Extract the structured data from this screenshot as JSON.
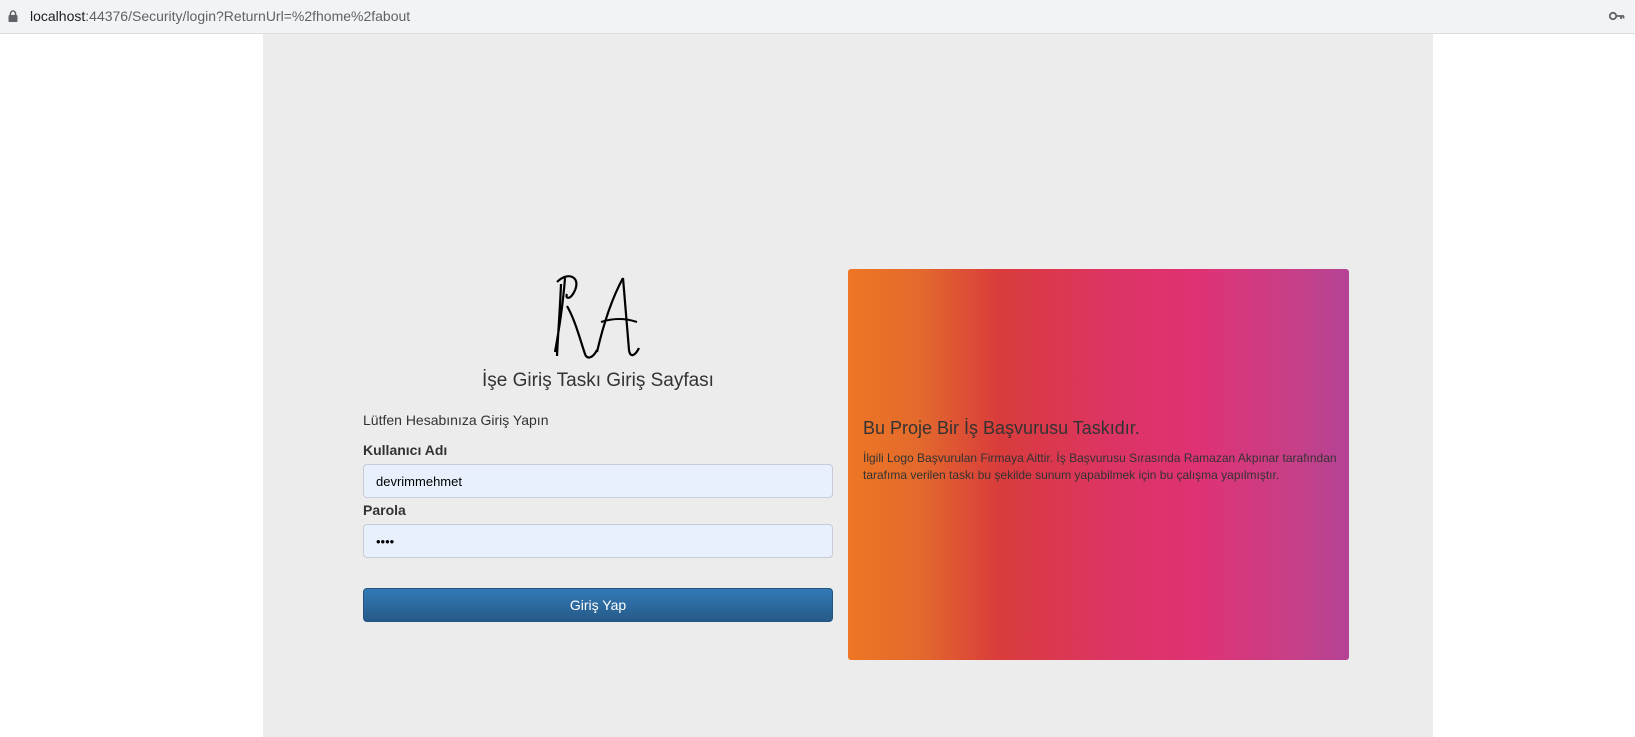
{
  "browser": {
    "url_host": "localhost",
    "url_rest": ":44376/Security/login?ReturnUrl=%2fhome%2fabout",
    "lock_icon": "lock-icon",
    "key_icon": "key-icon"
  },
  "login": {
    "logo_text": "RA",
    "title": "İşe Giriş Taskı Giriş Sayfası",
    "subtitle": "Lütfen Hesabınıza Giriş Yapın",
    "username_label": "Kullanıcı Adı",
    "username_value": "devrimmehmet",
    "password_label": "Parola",
    "password_value": "1234",
    "submit_label": "Giriş Yap"
  },
  "info_panel": {
    "title": "Bu Proje Bir İş Başvurusu Taskıdır.",
    "text": "İlgili Logo Başvurulan Firmaya Aittir. İş Başvurusu Sırasında Ramazan Akpınar tarafından tarafıma verilen taskı bu şekilde sunum yapabilmek için bu çalışma yapılmıştır."
  },
  "colors": {
    "page_bg": "#ececec",
    "button": "#2d6ca2",
    "gradient": [
      "#ee7624",
      "#da3c3b",
      "#dc3463",
      "#b44295"
    ]
  }
}
